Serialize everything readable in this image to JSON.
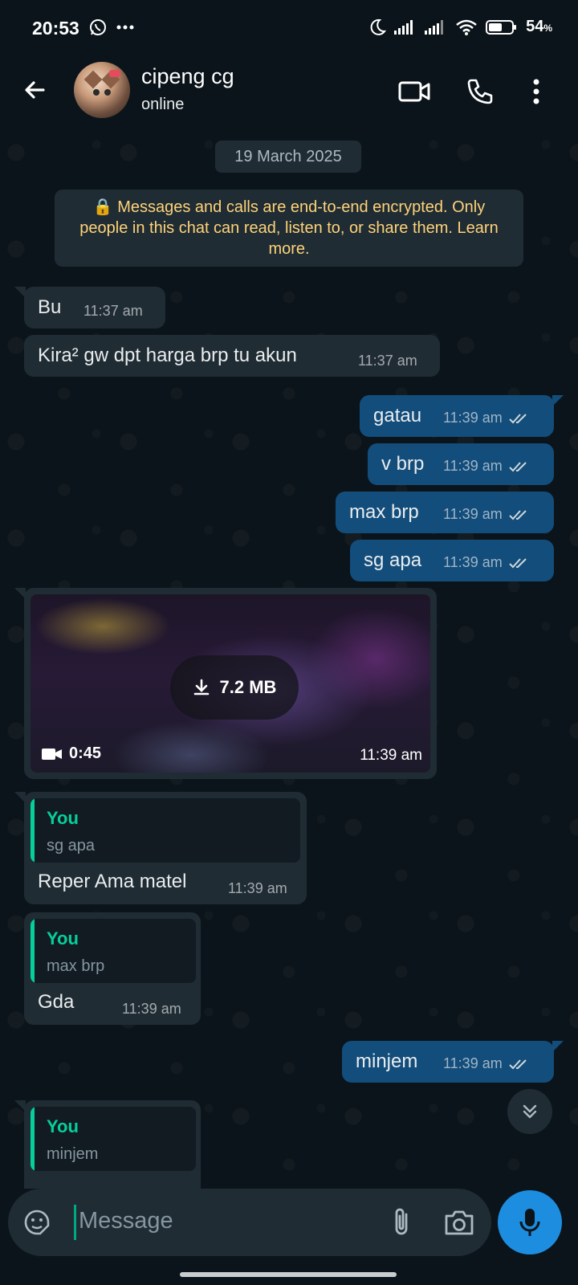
{
  "status_bar": {
    "time": "20:53",
    "battery": "54",
    "battery_unit": "%",
    "icons": [
      "whatsapp-icon",
      "more-dots-icon",
      "moon-icon",
      "signal-icon",
      "signal-icon",
      "wifi-icon",
      "battery-icon"
    ]
  },
  "header": {
    "name": "cipeng cg",
    "status": "online",
    "icons": [
      "back-arrow-icon",
      "video-call-icon",
      "phone-icon",
      "more-vert-icon"
    ]
  },
  "chat": {
    "date": "19 March 2025",
    "encryption_notice": "🔒 Messages and calls are end-to-end encrypted. Only people in this chat can read, listen to, or share them. Learn more.",
    "messages": [
      {
        "dir": "in",
        "text": "Bu",
        "time": "11:37 am"
      },
      {
        "dir": "in",
        "text": "Kira² gw dpt harga brp tu akun",
        "time": "11:37 am"
      },
      {
        "dir": "out",
        "text": "gatau",
        "time": "11:39 am",
        "status": "read"
      },
      {
        "dir": "out",
        "text": "v brp",
        "time": "11:39 am",
        "status": "read"
      },
      {
        "dir": "out",
        "text": "max brp",
        "time": "11:39 am",
        "status": "read"
      },
      {
        "dir": "out",
        "text": "sg apa",
        "time": "11:39 am",
        "status": "read"
      },
      {
        "dir": "in",
        "type": "video",
        "size": "7.2 MB",
        "duration": "0:45",
        "time": "11:39 am"
      },
      {
        "dir": "in",
        "quote_author": "You",
        "quote_text": "sg apa",
        "text": "Reper Ama matel",
        "time": "11:39 am"
      },
      {
        "dir": "in",
        "quote_author": "You",
        "quote_text": "max brp",
        "text": "Gda",
        "time": "11:39 am"
      },
      {
        "dir": "out",
        "text": "minjem",
        "time": "11:39 am",
        "status": "read"
      },
      {
        "dir": "in",
        "quote_author": "You",
        "quote_text": "minjem",
        "text": "",
        "time": ""
      }
    ]
  },
  "input": {
    "placeholder": "Message"
  },
  "colors": {
    "background": "#0b141a",
    "incoming_bubble": "#202c33",
    "outgoing_bubble": "#134d7b",
    "accent_green": "#06cf9c",
    "mic_button": "#1d8de0",
    "encryption_text": "#ffd279"
  }
}
